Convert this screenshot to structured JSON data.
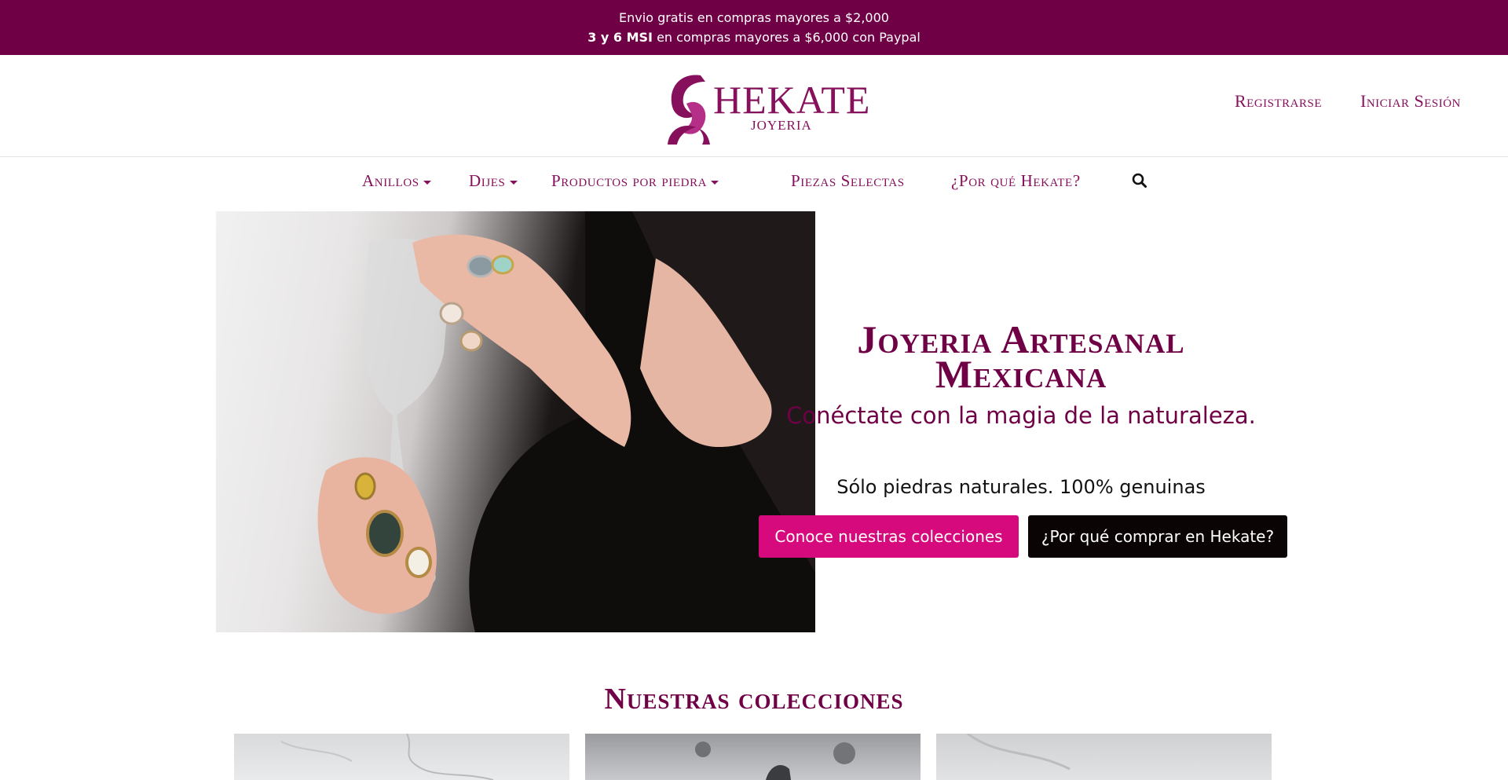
{
  "announcement": {
    "line1": "Envio gratis en compras mayores a $2,000",
    "line2_bold": "3 y 6 MSI",
    "line2_rest": " en compras mayores a $6,000 con Paypal"
  },
  "header": {
    "logo_text": "HEKATE",
    "logo_sub": "JOYERIA",
    "register": "Registrarse",
    "login": "Iniciar Sesión"
  },
  "nav": {
    "items": [
      {
        "label": "Anillos",
        "dropdown": true
      },
      {
        "label": "Dijes",
        "dropdown": true
      },
      {
        "label": "Productos por piedra",
        "dropdown": true
      },
      {
        "label": "Piezas Selectas",
        "dropdown": false
      },
      {
        "label": "¿Por qué Hekate?",
        "dropdown": false
      }
    ],
    "search_icon": "search-icon"
  },
  "hero": {
    "title_line1": "Joyeria Artesanal",
    "title_line2": "Mexicana",
    "subtitle": "Conéctate con la magia de la naturaleza.",
    "note": "Sólo piedras naturales. 100% genuinas",
    "btn_collections": "Conoce nuestras colecciones",
    "btn_why": "¿Por qué comprar en Hekate?"
  },
  "collections": {
    "title": "Nuestras colecciones"
  },
  "colors": {
    "brand": "#700046",
    "accent": "#d6097d",
    "dark_button": "#0b0405"
  }
}
